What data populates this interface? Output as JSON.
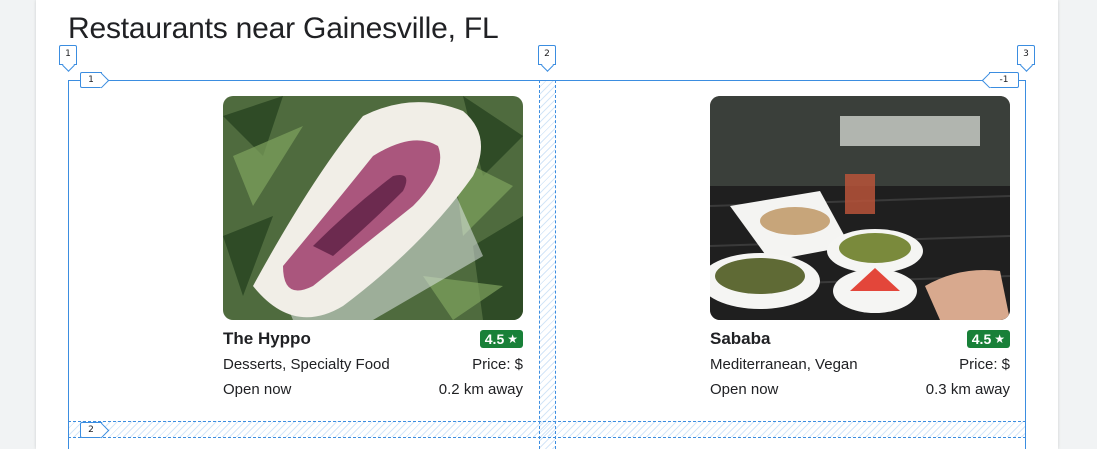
{
  "page_title": "Restaurants near Gainesville, FL",
  "grid_overlay": {
    "column_labels": [
      "1",
      "2",
      "3"
    ],
    "row_labels": [
      "1",
      "2"
    ],
    "row_end_label": "-1"
  },
  "restaurants": [
    {
      "name": "The Hyppo",
      "rating": "4.5",
      "categories": "Desserts, Specialty Food",
      "price": "Price: $",
      "status": "Open now",
      "distance": "0.2 km away",
      "photo_icon": "popsicle-photo"
    },
    {
      "name": "Sababa",
      "rating": "4.5",
      "categories": "Mediterranean, Vegan",
      "price": "Price: $",
      "status": "Open now",
      "distance": "0.3 km away",
      "photo_icon": "mediterranean-meal-photo"
    }
  ],
  "colors": {
    "rating_badge": "#188038",
    "grid_overlay": "#3b8de0",
    "text": "#202124"
  }
}
